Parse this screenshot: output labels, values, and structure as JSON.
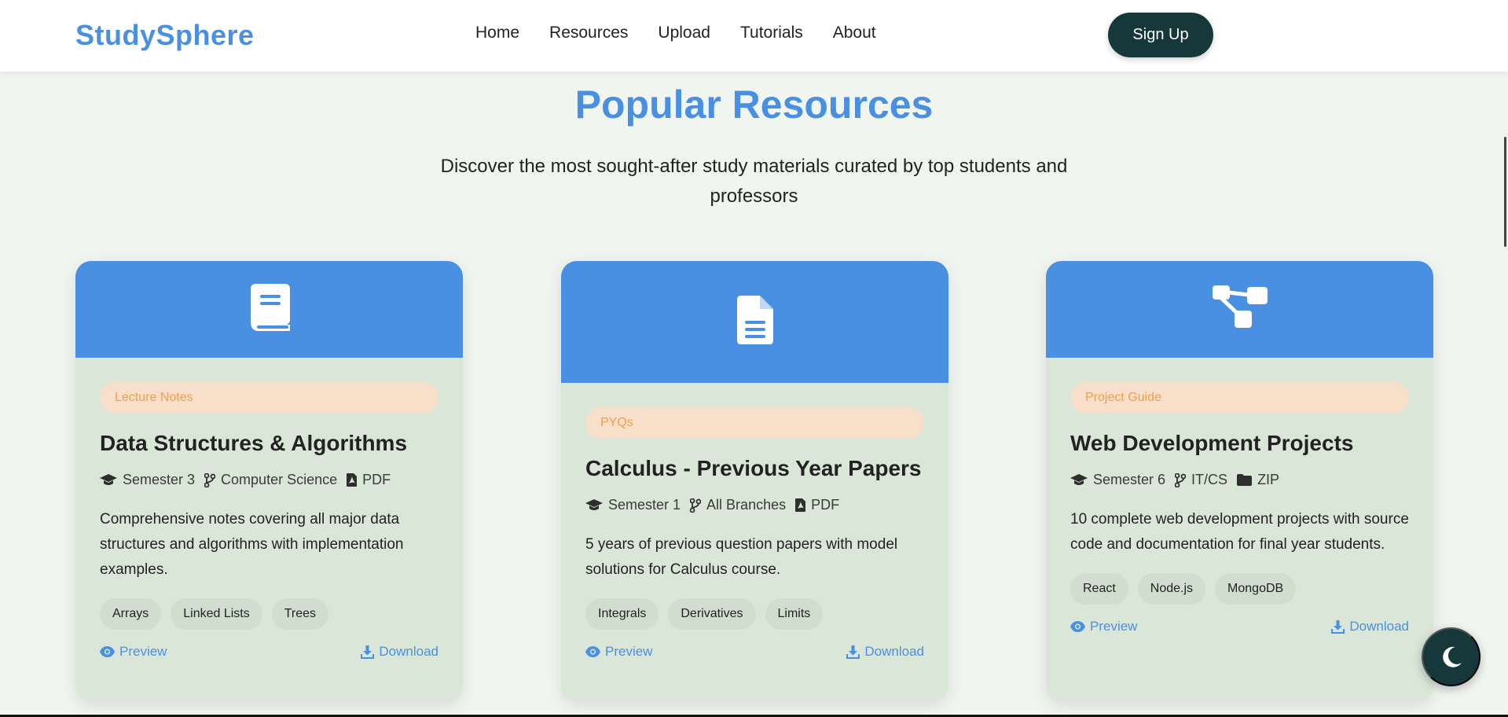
{
  "brand": {
    "name": "StudySphere"
  },
  "nav": {
    "links": [
      "Home",
      "Resources",
      "Upload",
      "Tutorials",
      "About"
    ],
    "signup_label": "Sign Up"
  },
  "section": {
    "title": "Popular Resources",
    "subtitle": "Discover the most sought-after study materials curated by top students and professors"
  },
  "colors": {
    "accent": "#4a90e2",
    "dark": "#16383a",
    "card_bg": "#dae6d8",
    "badge_bg": "#f7dfc9",
    "badge_text": "#f0a04b"
  },
  "cards": [
    {
      "icon": "book-icon",
      "category": "Lecture Notes",
      "title": "Data Structures & Algorithms",
      "semester": "Semester 3",
      "branch": "Computer Science",
      "format": "PDF",
      "format_icon": "file-pdf-icon",
      "description": "Comprehensive notes covering all major data structures and algorithms with implementation examples.",
      "tags": [
        "Arrays",
        "Linked Lists",
        "Trees"
      ],
      "preview_label": "Preview",
      "download_label": "Download"
    },
    {
      "icon": "file-text-icon",
      "category": "PYQs",
      "title": "Calculus - Previous Year Papers",
      "semester": "Semester 1",
      "branch": "All Branches",
      "format": "PDF",
      "format_icon": "file-pdf-icon",
      "description": "5 years of previous question papers with model solutions for Calculus course.",
      "tags": [
        "Integrals",
        "Derivatives",
        "Limits"
      ],
      "preview_label": "Preview",
      "download_label": "Download"
    },
    {
      "icon": "sitemap-icon",
      "category": "Project Guide",
      "title": "Web Development Projects",
      "semester": "Semester 6",
      "branch": "IT/CS",
      "format": "ZIP",
      "format_icon": "folder-icon",
      "description": "10 complete web development projects with source code and documentation for final year students.",
      "tags": [
        "React",
        "Node.js",
        "MongoDB"
      ],
      "preview_label": "Preview",
      "download_label": "Download"
    }
  ]
}
